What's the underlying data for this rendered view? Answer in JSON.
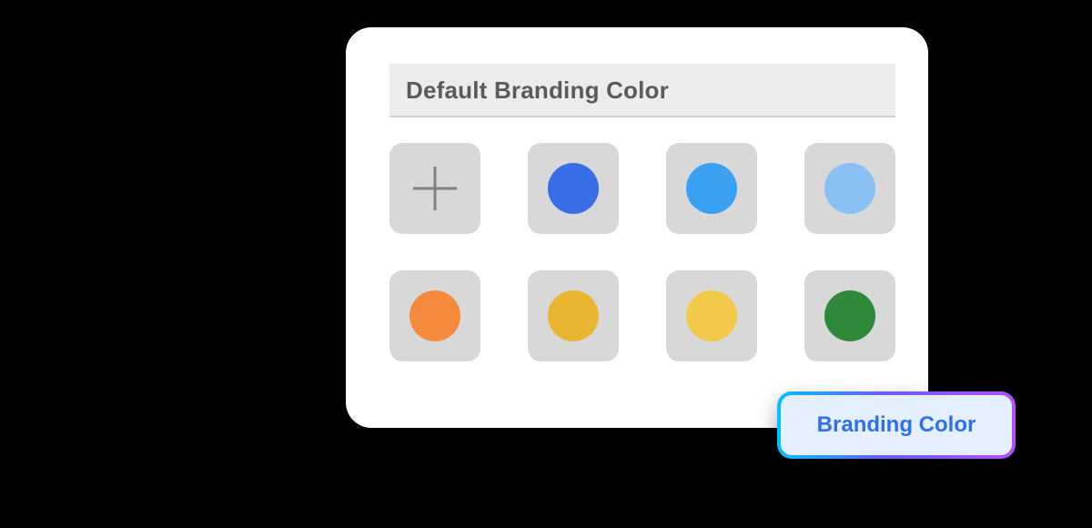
{
  "header": {
    "title": "Default Branding Color"
  },
  "swatches": [
    {
      "type": "add",
      "color": null,
      "icon": "plus-icon"
    },
    {
      "type": "color",
      "color": "#3a6ee8",
      "name": "blue"
    },
    {
      "type": "color",
      "color": "#3aa0f2",
      "name": "sky-blue"
    },
    {
      "type": "color",
      "color": "#8bc0f4",
      "name": "light-blue"
    },
    {
      "type": "color",
      "color": "#f58a3c",
      "name": "orange"
    },
    {
      "type": "color",
      "color": "#eab531",
      "name": "gold"
    },
    {
      "type": "color",
      "color": "#f3c949",
      "name": "yellow"
    },
    {
      "type": "color",
      "color": "#2e8a3a",
      "name": "green"
    }
  ],
  "callout": {
    "label": "Branding Color"
  }
}
